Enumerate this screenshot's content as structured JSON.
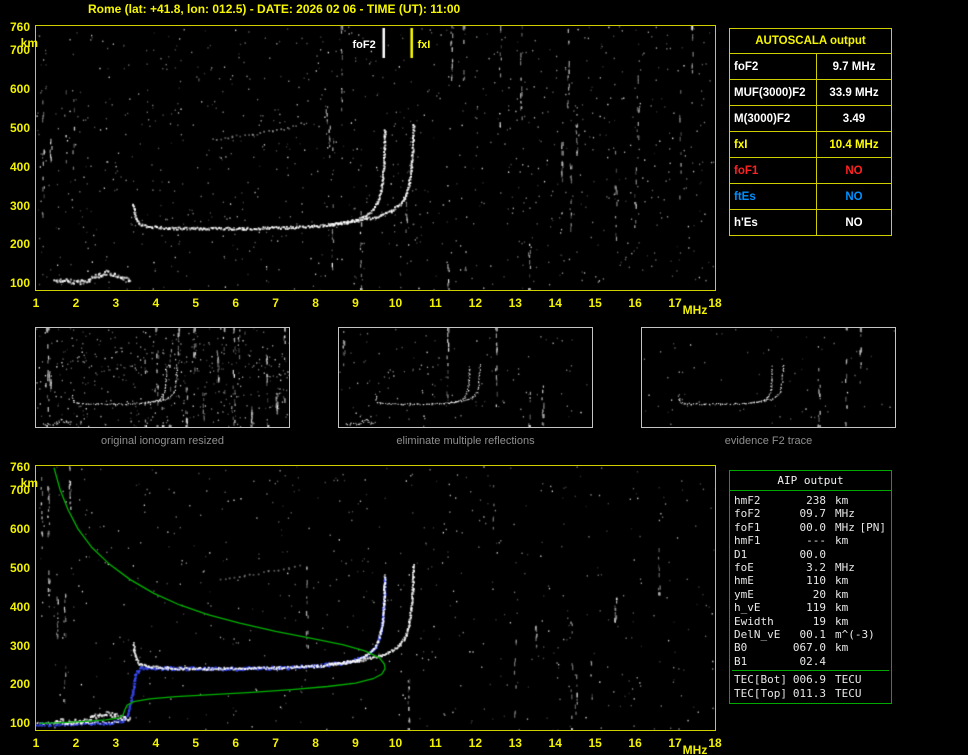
{
  "title": "Rome (lat: +41.8, lon: 012.5) - DATE: 2026 02 06 - TIME (UT): 11:00",
  "axes": {
    "x_ticks": [
      1,
      2,
      3,
      4,
      5,
      6,
      7,
      8,
      9,
      10,
      11,
      12,
      13,
      14,
      15,
      16,
      17,
      18
    ],
    "x_label": "MHz",
    "y_ticks": [
      760,
      700,
      600,
      500,
      400,
      300,
      200,
      100
    ],
    "y_label": "km"
  },
  "markers": {
    "foF2": {
      "label": "foF2",
      "freq": 9.7,
      "color": "#ffffff"
    },
    "fxI": {
      "label": "fxI",
      "freq": 10.4,
      "color": "#ffff00"
    }
  },
  "autoscala": {
    "header": "AUTOSCALA output",
    "rows": [
      {
        "label": "foF2",
        "value": "9.7 MHz",
        "color": "#ffffff"
      },
      {
        "label": "MUF(3000)F2",
        "value": "33.9 MHz",
        "color": "#ffffff"
      },
      {
        "label": "M(3000)F2",
        "value": "3.49",
        "color": "#ffffff"
      },
      {
        "label": "fxI",
        "value": "10.4 MHz",
        "color": "#ffff00"
      },
      {
        "label": "foF1",
        "value": "NO",
        "color": "#ff2222"
      },
      {
        "label": "ftEs",
        "value": "NO",
        "color": "#0090ff"
      },
      {
        "label": "h'Es",
        "value": "NO",
        "color": "#ffffff"
      }
    ]
  },
  "aip": {
    "header": "AIP output",
    "rows": [
      {
        "label": "hmF2",
        "value": "238",
        "unit": "km",
        "extra": ""
      },
      {
        "label": "foF2",
        "value": "09.7",
        "unit": "MHz",
        "extra": ""
      },
      {
        "label": "foF1",
        "value": "00.0",
        "unit": "MHz",
        "extra": "[PN]"
      },
      {
        "label": "hmF1",
        "value": "---",
        "unit": "km",
        "extra": ""
      },
      {
        "label": "D1",
        "value": "00.0",
        "unit": "",
        "extra": ""
      },
      {
        "label": "foE",
        "value": "3.2",
        "unit": "MHz",
        "extra": ""
      },
      {
        "label": "hmE",
        "value": "110",
        "unit": "km",
        "extra": ""
      },
      {
        "label": "ymE",
        "value": "20",
        "unit": "km",
        "extra": ""
      },
      {
        "label": "h_vE",
        "value": "119",
        "unit": "km",
        "extra": ""
      },
      {
        "label": "Ewidth",
        "value": "19",
        "unit": "km",
        "extra": ""
      },
      {
        "label": "DelN_vE",
        "value": "00.1",
        "unit": "m^(-3)",
        "extra": ""
      },
      {
        "label": "B0",
        "value": "067.0",
        "unit": "km",
        "extra": ""
      },
      {
        "label": "B1",
        "value": "02.4",
        "unit": "",
        "extra": ""
      }
    ],
    "tec_rows": [
      {
        "label": "TEC[Bot]",
        "value": "006.9",
        "unit": "TECU",
        "extra": ""
      },
      {
        "label": "TEC[Top]",
        "value": "011.3",
        "unit": "TECU",
        "extra": ""
      }
    ]
  },
  "thumbnails": [
    {
      "caption": "original ionogram resized",
      "noise_dots": 420,
      "noise_streaks": 22,
      "trace_set": "all",
      "seed": 21
    },
    {
      "caption": "eliminate multiple reflections",
      "noise_dots": 110,
      "noise_streaks": 6,
      "trace_set": "all",
      "seed": 22
    },
    {
      "caption": "evidence F2 trace",
      "noise_dots": 70,
      "noise_streaks": 3,
      "trace_set": "f2",
      "seed": 23
    }
  ],
  "chart_data": [
    {
      "type": "scatter",
      "title": "ionogram",
      "xlabel": "MHz",
      "ylabel": "km",
      "xlim": [
        1,
        18
      ],
      "ylim": [
        80,
        760
      ],
      "grid": false,
      "seed": 7,
      "noise_dots": 1000,
      "noise_streaks": 26,
      "markers": [
        {
          "name": "foF2",
          "x": 9.7,
          "color": "#ffffff"
        },
        {
          "name": "fxI",
          "x": 10.4,
          "color": "#ffff00"
        }
      ],
      "series": [
        {
          "name": "second-hop-trace",
          "color": "#d0d0d0",
          "density": 0.25,
          "alpha": 0.6,
          "points": [
            [
              5.4,
              468
            ],
            [
              5.9,
              476
            ],
            [
              6.4,
              483
            ],
            [
              6.9,
              491
            ],
            [
              7.3,
              499
            ],
            [
              7.6,
              509
            ]
          ]
        },
        {
          "name": "Es-trace",
          "color": "#ffffff",
          "spread": 5,
          "size": 2,
          "points": [
            [
              1.45,
              106
            ],
            [
              1.8,
              103
            ],
            [
              2.1,
              103
            ],
            [
              2.35,
              110
            ],
            [
              2.55,
              120
            ],
            [
              2.75,
              126
            ],
            [
              2.95,
              120
            ],
            [
              3.15,
              113
            ],
            [
              3.35,
              110
            ]
          ]
        },
        {
          "name": "F2-extraordinary-trace",
          "color": "#ffffff",
          "points": [
            [
              8.3,
              251
            ],
            [
              8.8,
              256
            ],
            [
              9.2,
              263
            ],
            [
              9.6,
              273
            ],
            [
              9.9,
              286
            ],
            [
              10.1,
              302
            ],
            [
              10.25,
              325
            ],
            [
              10.33,
              355
            ],
            [
              10.38,
              395
            ],
            [
              10.41,
              435
            ],
            [
              10.43,
              475
            ],
            [
              10.44,
              508
            ]
          ]
        },
        {
          "name": "F2-ordinary-trace",
          "color": "#ffffff",
          "points": [
            [
              3.42,
              305
            ],
            [
              3.48,
              268
            ],
            [
              3.56,
              252
            ],
            [
              3.8,
              245
            ],
            [
              4.3,
              241
            ],
            [
              5.2,
              240
            ],
            [
              6.2,
              240
            ],
            [
              7.2,
              242
            ],
            [
              8.0,
              246
            ],
            [
              8.5,
              252
            ],
            [
              9.0,
              261
            ],
            [
              9.25,
              273
            ],
            [
              9.42,
              288
            ],
            [
              9.54,
              308
            ],
            [
              9.62,
              335
            ],
            [
              9.67,
              368
            ],
            [
              9.7,
              405
            ],
            [
              9.71,
              445
            ],
            [
              9.72,
              480
            ],
            [
              9.72,
              497
            ]
          ]
        }
      ]
    },
    {
      "type": "scatter",
      "title": "scaled ionogram with electron density profile",
      "xlabel": "MHz",
      "ylabel": "km",
      "xlim": [
        1,
        18
      ],
      "ylim": [
        80,
        760
      ],
      "grid": false,
      "seed": 13,
      "noise_dots": 560,
      "noise_streaks": 16,
      "series": [
        {
          "name": "second-hop-trace",
          "color": "#d0d0d0",
          "density": 0.2,
          "alpha": 0.55,
          "points": [
            [
              5.6,
              470
            ],
            [
              6.2,
              480
            ],
            [
              6.8,
              489
            ],
            [
              7.3,
              499
            ],
            [
              7.6,
              508
            ]
          ]
        },
        {
          "name": "model-trace",
          "color": "#3a4cff",
          "size": 2.1,
          "spread": 3.5,
          "density": 0.9,
          "points": [
            [
              1.0,
              96
            ],
            [
              1.7,
              97
            ],
            [
              2.4,
              99
            ],
            [
              2.9,
              101
            ],
            [
              3.15,
              106
            ],
            [
              3.3,
              125
            ],
            [
              3.4,
              175
            ],
            [
              3.47,
              225
            ],
            [
              3.6,
              241
            ],
            [
              4.2,
              241
            ],
            [
              5.2,
              240
            ],
            [
              6.2,
              240
            ],
            [
              7.2,
              242
            ],
            [
              8.0,
              247
            ],
            [
              8.6,
              254
            ],
            [
              9.05,
              264
            ],
            [
              9.3,
              277
            ],
            [
              9.47,
              294
            ],
            [
              9.58,
              320
            ],
            [
              9.65,
              355
            ],
            [
              9.69,
              400
            ],
            [
              9.71,
              445
            ],
            [
              9.72,
              478
            ]
          ]
        },
        {
          "name": "Es-trace",
          "color": "#ffffff",
          "spread": 5,
          "size": 2,
          "points": [
            [
              1.45,
              106
            ],
            [
              1.8,
              103
            ],
            [
              2.1,
              103
            ],
            [
              2.35,
              110
            ],
            [
              2.55,
              120
            ],
            [
              2.75,
              126
            ],
            [
              2.95,
              120
            ],
            [
              3.15,
              113
            ],
            [
              3.35,
              110
            ]
          ]
        },
        {
          "name": "bottom-Es-line",
          "color": "#ffffff",
          "density": 0.55,
          "size": 1.5,
          "spread": 2,
          "points": [
            [
              1.0,
              99
            ],
            [
              2.0,
              100
            ],
            [
              3.05,
              102
            ]
          ]
        },
        {
          "name": "F2-extraordinary-trace",
          "color": "#ffffff",
          "points": [
            [
              8.3,
              251
            ],
            [
              8.8,
              256
            ],
            [
              9.2,
              263
            ],
            [
              9.6,
              273
            ],
            [
              9.9,
              286
            ],
            [
              10.1,
              302
            ],
            [
              10.25,
              325
            ],
            [
              10.33,
              355
            ],
            [
              10.38,
              395
            ],
            [
              10.41,
              435
            ],
            [
              10.43,
              475
            ],
            [
              10.44,
              508
            ]
          ]
        },
        {
          "name": "F2-ordinary-trace",
          "color": "#ffffff",
          "points": [
            [
              3.42,
              305
            ],
            [
              3.48,
              268
            ],
            [
              3.56,
              252
            ],
            [
              3.8,
              245
            ],
            [
              4.3,
              241
            ],
            [
              5.2,
              240
            ],
            [
              6.2,
              240
            ],
            [
              7.2,
              242
            ],
            [
              8.0,
              246
            ],
            [
              8.5,
              252
            ],
            [
              9.0,
              261
            ],
            [
              9.25,
              273
            ],
            [
              9.42,
              288
            ],
            [
              9.54,
              308
            ],
            [
              9.62,
              335
            ],
            [
              9.67,
              368
            ],
            [
              9.7,
              405
            ],
            [
              9.71,
              445
            ],
            [
              9.72,
              480
            ]
          ]
        },
        {
          "name": "electron-density-profile",
          "color": "#00b400",
          "style": "line",
          "points": [
            [
              1.45,
              756
            ],
            [
              1.6,
              700
            ],
            [
              1.8,
              648
            ],
            [
              2.05,
              598
            ],
            [
              2.4,
              550
            ],
            [
              2.85,
              506
            ],
            [
              3.35,
              468
            ],
            [
              3.95,
              432
            ],
            [
              4.6,
              402
            ],
            [
              5.3,
              377
            ],
            [
              6.1,
              355
            ],
            [
              7.0,
              334
            ],
            [
              7.9,
              316
            ],
            [
              8.7,
              299
            ],
            [
              9.25,
              283
            ],
            [
              9.6,
              266
            ],
            [
              9.72,
              250
            ],
            [
              9.74,
              238
            ],
            [
              9.66,
              224
            ],
            [
              9.44,
              212
            ],
            [
              9.0,
              201
            ],
            [
              8.3,
              192
            ],
            [
              7.4,
              184
            ],
            [
              6.4,
              177
            ],
            [
              5.4,
              171
            ],
            [
              4.5,
              166
            ],
            [
              3.85,
              160
            ],
            [
              3.45,
              153
            ],
            [
              3.28,
              144
            ],
            [
              3.22,
              131
            ],
            [
              3.18,
              119
            ],
            [
              3.08,
              111
            ],
            [
              2.75,
              106
            ],
            [
              2.25,
              102
            ],
            [
              1.65,
              99
            ],
            [
              1.1,
              97
            ]
          ]
        }
      ]
    }
  ]
}
